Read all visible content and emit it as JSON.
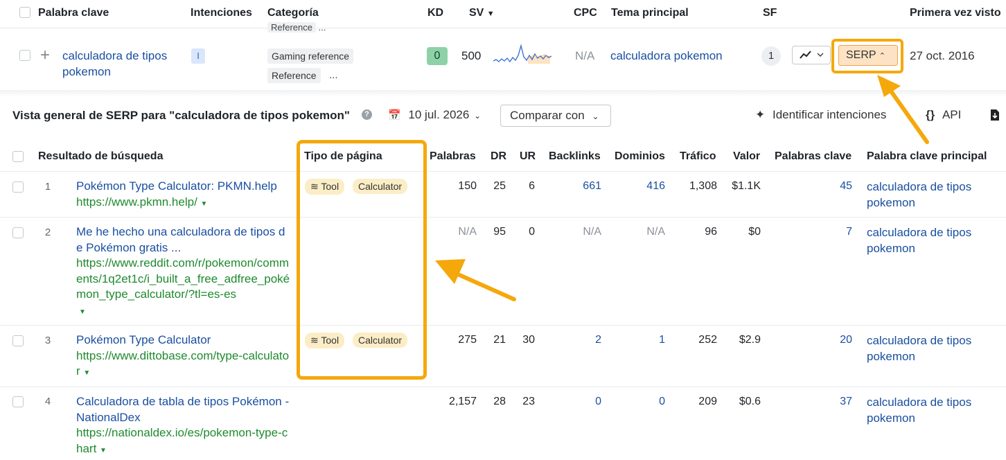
{
  "top_header": {
    "col_keyword": "Palabra clave",
    "col_intents": "Intenciones",
    "col_category": "Categoría",
    "col_kd": "KD",
    "col_sv": "SV",
    "col_cpc": "CPC",
    "col_topic": "Tema principal",
    "col_sf": "SF",
    "col_first_seen": "Primera vez visto"
  },
  "cutoff_row": {
    "tag": "Reference",
    "more": "..."
  },
  "keyword_row": {
    "expand": "+",
    "keyword": "calculadora de tipos pokemon",
    "intent": "I",
    "categories": [
      "Gaming reference",
      "Reference"
    ],
    "more": "...",
    "kd": "0",
    "sv": "500",
    "cpc": "N/A",
    "topic": "calculadora pokemon",
    "sf": "1",
    "serp_label": "SERP",
    "first_seen": "27 oct. 2016"
  },
  "overview": {
    "title": "Vista general de SERP para \"calculadora de tipos pokemon\"",
    "date": "10 jul. 2026",
    "compare": "Comparar con",
    "identify": "Identificar intenciones",
    "api": "API"
  },
  "serp_header": {
    "result": "Resultado de búsqueda",
    "page_type": "Tipo de página",
    "words": "Palabras",
    "dr": "DR",
    "ur": "UR",
    "backlinks": "Backlinks",
    "domains": "Dominios",
    "traffic": "Tráfico",
    "value": "Valor",
    "keywords": "Palabras clave",
    "main_keyword": "Palabra clave principal"
  },
  "serp_rows": [
    {
      "idx": "1",
      "title": "Pokémon Type Calculator: PKMN.help",
      "url": "https://www.pkmn.help/",
      "tags": [
        "Tool",
        "Calculator"
      ],
      "words": "150",
      "dr": "25",
      "ur": "6",
      "backlinks": "661",
      "domains": "416",
      "traffic": "1,308",
      "value": "$1.1K",
      "keywords": "45",
      "main_keyword": "calculadora de tipos pokemon"
    },
    {
      "idx": "2",
      "title": "Me he hecho una calculadora de tipos de Pokémon gratis ...",
      "url": "https://www.reddit.com/r/pokemon/comments/1q2et1c/i_built_a_free_adfree_pokémon_type_calculator/?tl=es-es",
      "tags": [],
      "words": "N/A",
      "dr": "95",
      "ur": "0",
      "backlinks": "N/A",
      "domains": "N/A",
      "traffic": "96",
      "value": "$0",
      "keywords": "7",
      "main_keyword": "calculadora de tipos pokemon"
    },
    {
      "idx": "3",
      "title": "Pokémon Type Calculator",
      "url": "https://www.dittobase.com/type-calculator",
      "tags": [
        "Tool",
        "Calculator"
      ],
      "words": "275",
      "dr": "21",
      "ur": "30",
      "backlinks": "2",
      "domains": "1",
      "traffic": "252",
      "value": "$2.9",
      "keywords": "20",
      "main_keyword": "calculadora de tipos pokemon"
    },
    {
      "idx": "4",
      "title": "Calculadora de tabla de tipos Pokémon - NationalDex",
      "url": "https://nationaldex.io/es/pokemon-type-chart",
      "tags": [],
      "words": "2,157",
      "dr": "28",
      "ur": "23",
      "backlinks": "0",
      "domains": "0",
      "traffic": "209",
      "value": "$0.6",
      "keywords": "37",
      "main_keyword": "calculadora de tipos pokemon"
    }
  ],
  "colors": {
    "link": "#1a4fa0",
    "url": "#1e8a2e",
    "highlight": "#f5a80b",
    "tag_bg": "#fbedc6"
  }
}
